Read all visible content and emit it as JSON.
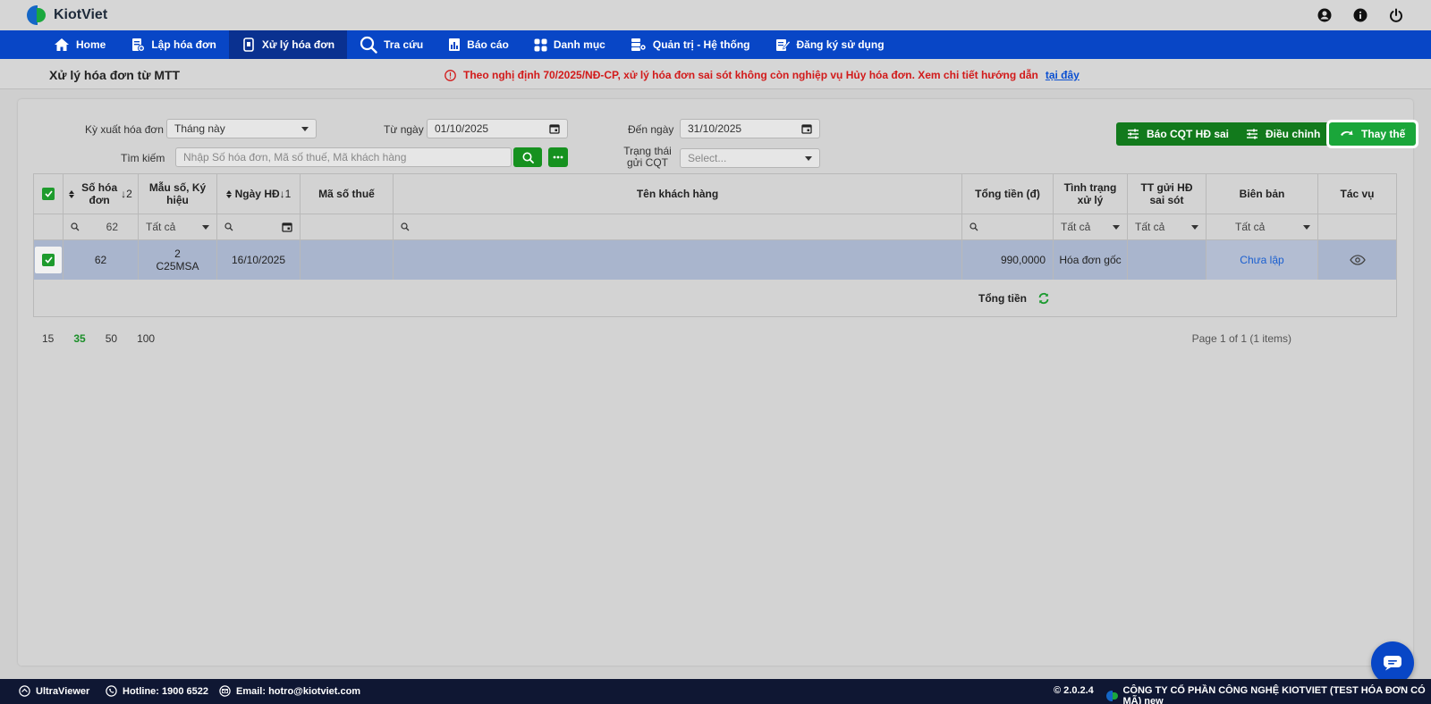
{
  "app": {
    "name": "KiotViet"
  },
  "nav": {
    "items": [
      {
        "label": "Home"
      },
      {
        "label": "Lập hóa đơn"
      },
      {
        "label": "Xử lý hóa đơn"
      },
      {
        "label": "Tra cứu"
      },
      {
        "label": "Báo cáo"
      },
      {
        "label": "Danh mục"
      },
      {
        "label": "Quản trị - Hệ thống"
      },
      {
        "label": "Đăng ký sử dụng"
      }
    ],
    "active_index": 2
  },
  "page": {
    "title": "Xử lý hóa đơn từ MTT",
    "notice": "Theo nghị định 70/2025/NĐ-CP, xử lý hóa đơn sai sót không còn nghiệp vụ Hủy hóa đơn. Xem chi tiết hướng dẫn",
    "notice_link": "tại đây"
  },
  "filters": {
    "period_label": "Kỳ xuất hóa đơn",
    "period_value": "Tháng này",
    "from_label": "Từ ngày",
    "from_value": "01/10/2025",
    "to_label": "Đến ngày",
    "to_value": "31/10/2025",
    "search_label": "Tìm kiếm",
    "search_placeholder": "Nhập Số hóa đơn, Mã số thuế, Mã khách hàng",
    "status_label_1": "Trạng thái",
    "status_label_2": "gửi CQT",
    "status_placeholder": "Select..."
  },
  "actions": {
    "report_wrong": "Báo CQT HĐ sai",
    "adjust": "Điều chỉnh",
    "replace": "Thay thế"
  },
  "table": {
    "headers": {
      "invoice_no": "Số hóa đơn",
      "invoice_no_sort": "2",
      "template": "Mẫu số, Ký hiệu",
      "date": "Ngày HĐ",
      "date_sort": "1",
      "tax_code": "Mã số thuế",
      "customer": "Tên khách hàng",
      "total": "Tổng tiền (đ)",
      "status": "Tình trạng xử lý",
      "tt_send": "TT gửi HĐ sai sót",
      "minutes": "Biên bản",
      "actions": "Tác vụ"
    },
    "filter_row": {
      "invoice_no": "62",
      "template": "Tất cả",
      "status": "Tất cả",
      "tt_send": "Tất cả",
      "minutes": "Tất cả"
    },
    "rows": [
      {
        "invoice_no": "62",
        "template_line1": "2",
        "template_line2": "C25MSA",
        "date": "16/10/2025",
        "tax_code": "",
        "customer": "",
        "total": "990,0000",
        "status": "Hóa đơn gốc",
        "tt_send": "",
        "minutes": "Chưa lập"
      }
    ],
    "total_label": "Tổng tiền"
  },
  "pager": {
    "sizes": [
      "15",
      "35",
      "50",
      "100"
    ],
    "active_size": "35",
    "info": "Page 1 of 1 (1 items)"
  },
  "footer": {
    "ultraviewer": "UltraViewer",
    "hotline": "Hotline: 1900 6522",
    "email": "Email: hotro@kiotviet.com",
    "version": "© 2.0.2.4",
    "company": "CÔNG TY CỔ PHẦN CÔNG NGHỆ KIOTVIET (TEST HÓA ĐƠN CÓ MÃ) new"
  },
  "colors": {
    "nav_bg": "#0846c6",
    "nav_active": "#0a3190",
    "primary_green": "#127a1c",
    "highlight_green": "#1aa63a",
    "notice_red": "#d21a1a",
    "selected_row": "#a9b5cd",
    "footer_bg": "#0f1733"
  },
  "icons": [
    "user-circle-icon",
    "info-icon",
    "power-icon",
    "home-icon",
    "invoice-create-icon",
    "invoice-process-icon",
    "search-icon",
    "report-icon",
    "catalog-icon",
    "admin-icon",
    "register-icon",
    "calendar-icon",
    "more-icon",
    "sliders-icon",
    "replace-icon",
    "eye-icon",
    "refresh-icon",
    "chat-icon"
  ]
}
